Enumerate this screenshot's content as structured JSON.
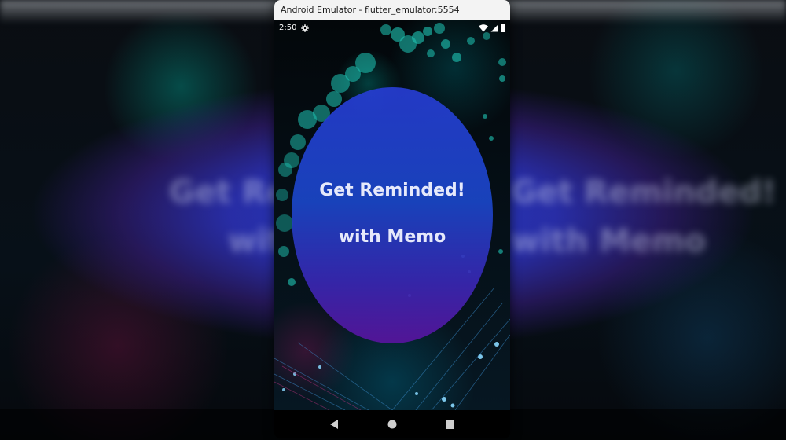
{
  "window": {
    "title": "Android Emulator - flutter_emulator:5554"
  },
  "status_bar": {
    "time": "2:50",
    "icons": [
      "settings-gear-icon",
      "wifi-icon",
      "signal-icon",
      "battery-icon"
    ]
  },
  "app": {
    "headline": "Get Reminded!",
    "subheadline": "with Memo",
    "colors": {
      "blob_top": "#263cd2",
      "blob_bottom": "#56149b",
      "text": "#e6e9fb",
      "accent_teal": "#1fc7b6"
    }
  },
  "nav_bar": {
    "buttons": [
      "back-icon",
      "home-icon",
      "recents-icon"
    ]
  }
}
